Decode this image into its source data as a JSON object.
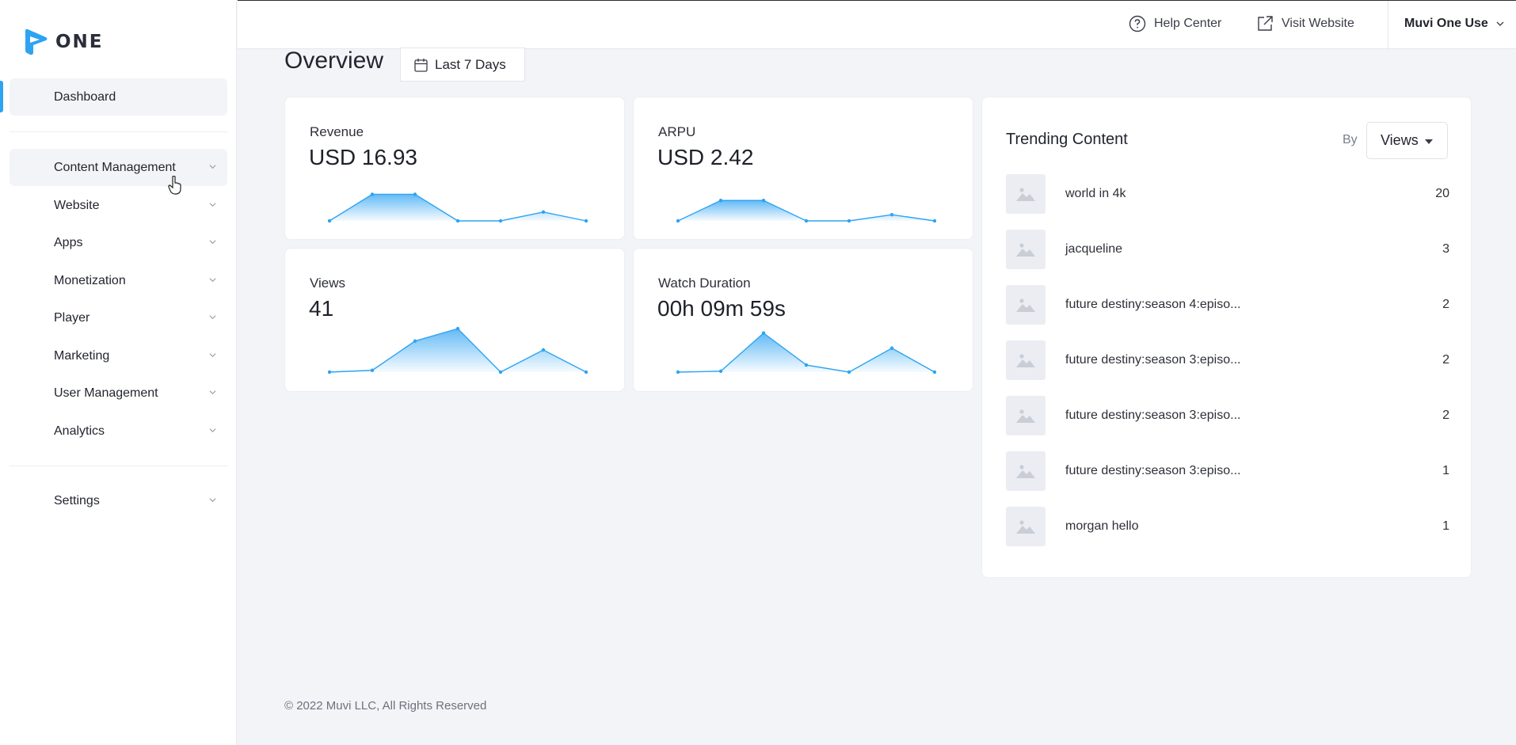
{
  "brand": {
    "logo_text": "ONE",
    "accent": "#2ea3f2"
  },
  "sidebar": {
    "dashboard": "Dashboard",
    "items": [
      {
        "label": "Content Management"
      },
      {
        "label": "Website"
      },
      {
        "label": "Apps"
      },
      {
        "label": "Monetization"
      },
      {
        "label": "Player"
      },
      {
        "label": "Marketing"
      },
      {
        "label": "User Management"
      },
      {
        "label": "Analytics"
      }
    ],
    "settings": "Settings"
  },
  "topbar": {
    "help_center": "Help Center",
    "visit_website": "Visit Website",
    "user": "Muvi One Use"
  },
  "overview": {
    "title": "Overview",
    "date_range": "Last 7 Days"
  },
  "cards": [
    {
      "label": "Revenue",
      "value": "USD 16.93",
      "trend": [
        0,
        3,
        3,
        0,
        0,
        1,
        0
      ]
    },
    {
      "label": "ARPU",
      "value": "USD 2.42",
      "trend": [
        0,
        2.3,
        2.3,
        0,
        0,
        0.7,
        0
      ]
    },
    {
      "label": "Views",
      "value": "41",
      "trend": [
        0,
        0.2,
        3.5,
        4.9,
        0,
        2.5,
        0
      ]
    },
    {
      "label": "Watch Duration",
      "value": "00h 09m 59s",
      "trend": [
        0,
        0.1,
        4.4,
        0.8,
        0,
        2.7,
        0
      ]
    }
  ],
  "trending": {
    "title": "Trending Content",
    "by_label": "By",
    "metric": "Views",
    "items": [
      {
        "name": "world in 4k",
        "count": "20"
      },
      {
        "name": "jacqueline",
        "count": "3"
      },
      {
        "name": "future destiny:season 4:episo...",
        "count": "2"
      },
      {
        "name": "future destiny:season 3:episo...",
        "count": "2"
      },
      {
        "name": "future destiny:season 3:episo...",
        "count": "2"
      },
      {
        "name": "future destiny:season 3:episo...",
        "count": "1"
      },
      {
        "name": "morgan hello",
        "count": "1"
      }
    ]
  },
  "footer": {
    "copyright": "© 2022 Muvi LLC, All Rights Reserved"
  }
}
